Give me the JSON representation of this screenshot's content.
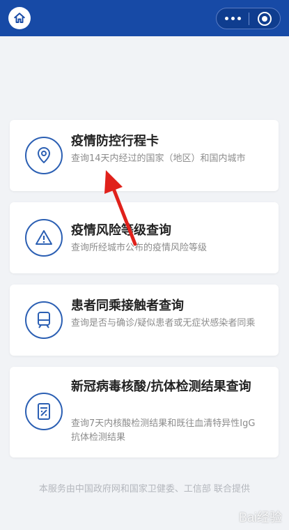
{
  "header": {
    "home_icon": "home-icon",
    "menu_icon": "more-dots-icon",
    "close_icon": "target-close-icon",
    "bar_color": "#174aa6"
  },
  "cards": [
    {
      "title": "疫情防控行程卡",
      "desc": "查询14天内经过的国家（地区）和国内城市",
      "icon": "location-pin-icon"
    },
    {
      "title": "疫情风险等级查询",
      "desc": "查询所经城市公布的疫情风险等级",
      "icon": "warning-triangle-icon"
    },
    {
      "title": "患者同乘接触者查询",
      "desc": "查询是否与确诊/疑似患者或无症状感染者同乘",
      "icon": "train-icon"
    },
    {
      "title": "新冠病毒核酸/抗体检测结果查询",
      "desc": "查询7天内核酸检测结果和既往血清特异性IgG抗体检测结果",
      "icon": "test-report-icon"
    }
  ],
  "footer": "本服务由中国政府网和国家卫健委、工信部 联合提供",
  "watermark": "Bai经验",
  "annotation_color": "#e0211b"
}
